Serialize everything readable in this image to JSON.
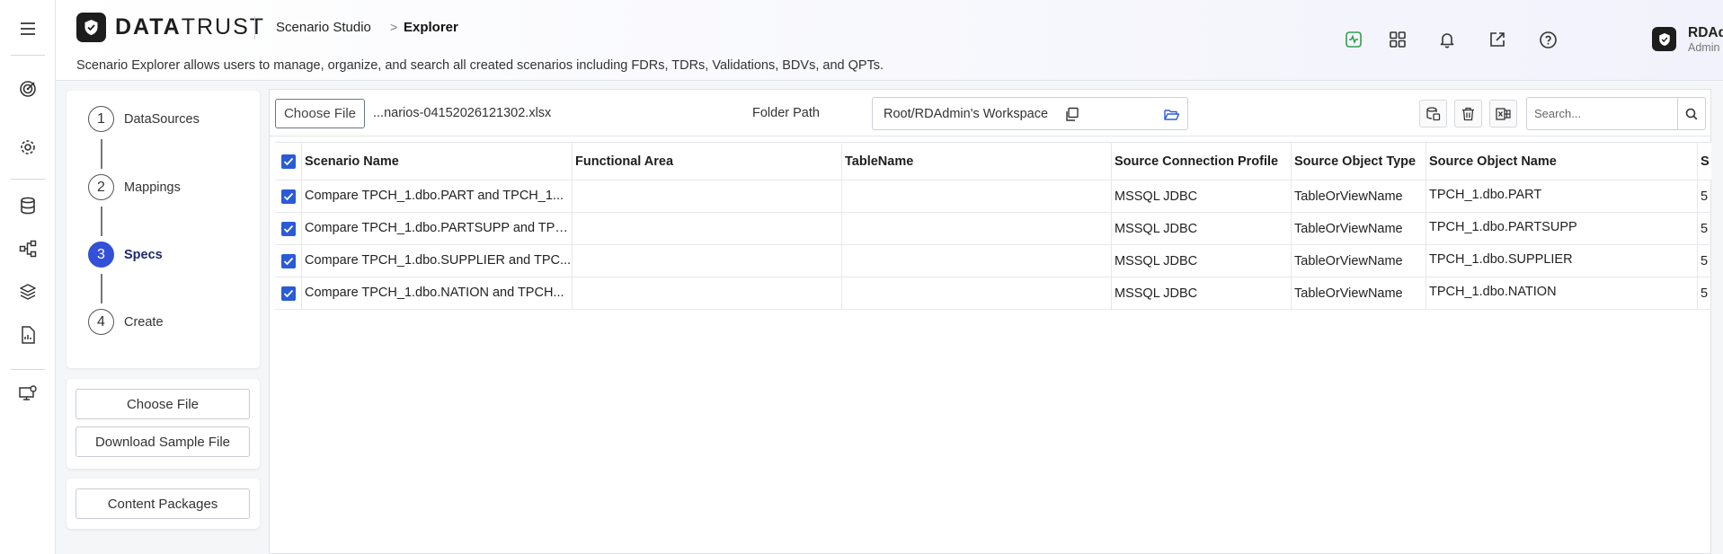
{
  "brand": {
    "logo_bold": "DATA",
    "logo_light": "TRUST"
  },
  "breadcrumb": {
    "parent": "Scenario Studio",
    "separator": ">",
    "current": "Explorer"
  },
  "description": "Scenario Explorer allows users to manage, organize, and search all created scenarios including FDRs, TDRs, Validations, BDVs, and QPTs.",
  "header_icons": [
    "activity-icon",
    "apps-grid-icon",
    "bell-icon",
    "external-link-icon",
    "help-icon"
  ],
  "user": {
    "name": "RDAdmin",
    "role": "Admin"
  },
  "sidebar_icons": [
    "menu-icon",
    "target-icon",
    "settings-icon",
    "database-icon",
    "workflow-icon",
    "layers-icon",
    "report-icon",
    "monitor-icon"
  ],
  "steps": [
    {
      "number": "1",
      "label": "DataSources",
      "active": false
    },
    {
      "number": "2",
      "label": "Mappings",
      "active": false
    },
    {
      "number": "3",
      "label": "Specs",
      "active": true
    },
    {
      "number": "4",
      "label": "Create",
      "active": false
    }
  ],
  "side_buttons": {
    "choose_file": "Choose File",
    "download_sample": "Download Sample File",
    "content_packages": "Content Packages"
  },
  "toolbar": {
    "choose_file": "Choose File",
    "file_name": "...narios-04152026121302.xlsx",
    "folder_label": "Folder Path",
    "folder_path": "Root/RDAdmin's Workspace",
    "search_placeholder": "Search..."
  },
  "table": {
    "columns": [
      "Scenario Name",
      "Functional Area",
      "TableName",
      "Source Connection Profile",
      "Source Object Type",
      "Source Object Name",
      "S"
    ],
    "rows": [
      {
        "checked": true,
        "scenario_name": "Compare TPCH_1.dbo.PART and TPCH_1...",
        "functional_area": "",
        "table_name": "",
        "source_connection_profile": "MSSQL JDBC",
        "source_object_type": "TableOrViewName",
        "source_object_name": "TPCH_1.dbo.PART",
        "extra": "5"
      },
      {
        "checked": true,
        "scenario_name": "Compare TPCH_1.dbo.PARTSUPP and TPC...",
        "functional_area": "",
        "table_name": "",
        "source_connection_profile": "MSSQL JDBC",
        "source_object_type": "TableOrViewName",
        "source_object_name": "TPCH_1.dbo.PARTSUPP",
        "extra": "5"
      },
      {
        "checked": true,
        "scenario_name": "Compare TPCH_1.dbo.SUPPLIER and TPC...",
        "functional_area": "",
        "table_name": "",
        "source_connection_profile": "MSSQL JDBC",
        "source_object_type": "TableOrViewName",
        "source_object_name": "TPCH_1.dbo.SUPPLIER",
        "extra": "5"
      },
      {
        "checked": true,
        "scenario_name": "Compare TPCH_1.dbo.NATION and TPCH...",
        "functional_area": "",
        "table_name": "",
        "source_connection_profile": "MSSQL JDBC",
        "source_object_type": "TableOrViewName",
        "source_object_name": "TPCH_1.dbo.NATION",
        "extra": "5"
      }
    ]
  },
  "colors": {
    "accent": "#3351d6",
    "checkbox": "#2a5bd7",
    "activity": "#2e9e4f",
    "folder_icon": "#2a5bd7"
  }
}
